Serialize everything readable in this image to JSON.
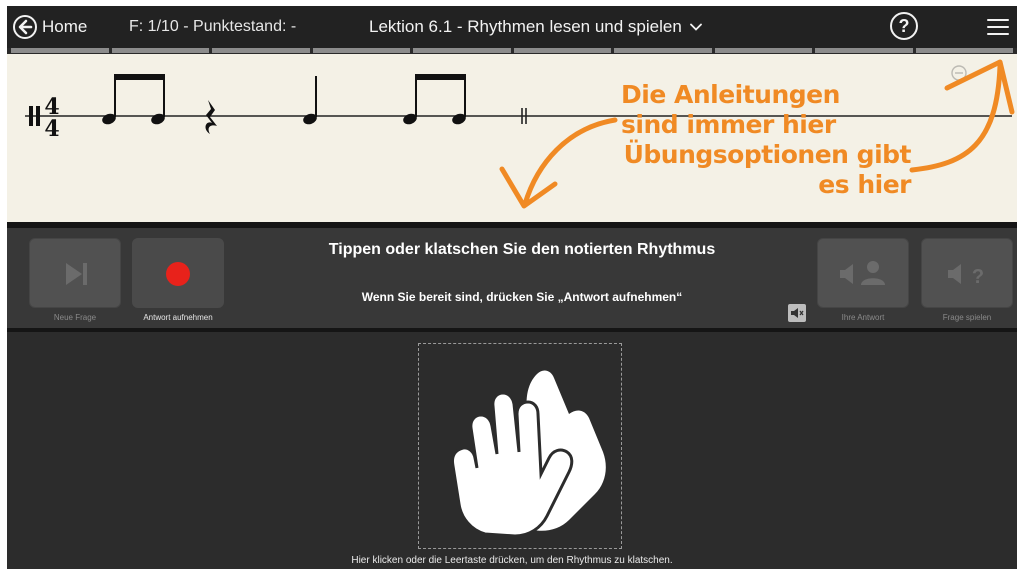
{
  "topbar": {
    "home_label": "Home",
    "score_text": "F: 1/10 - Punktestand: -",
    "lesson_title": "Lektion 6.1 - Rhythmen lesen und spielen",
    "help_symbol": "?",
    "progress_segments": 10
  },
  "staff": {
    "time_signature_top": "4",
    "time_signature_bottom": "4"
  },
  "annotations": {
    "line1": "Die Anleitungen sind immer hier",
    "line2": "Übungsoptionen gibt es hier",
    "color": "#f08a24"
  },
  "controls": {
    "new_question_label": "Neue Frage",
    "record_label": "Antwort aufnehmen",
    "instruction_main": "Tippen oder klatschen Sie den notierten Rhythmus",
    "instruction_sub": "Wenn Sie bereit sind, drücken Sie „Antwort aufnehmen“",
    "your_answer_label": "Ihre Antwort",
    "play_question_label": "Frage spielen",
    "record_color": "#e8221b"
  },
  "tap_area": {
    "caption": "Hier klicken oder die Leertaste drücken, um den Rhythmus zu klatschen."
  },
  "icons": [
    "back-arrow-icon",
    "chevron-down-icon",
    "help-icon",
    "hamburger-menu-icon",
    "skip-forward-icon",
    "record-icon",
    "speaker-person-icon",
    "speaker-question-icon",
    "speaker-muted-icon",
    "clapping-hands-icon",
    "zoom-out-icon"
  ]
}
